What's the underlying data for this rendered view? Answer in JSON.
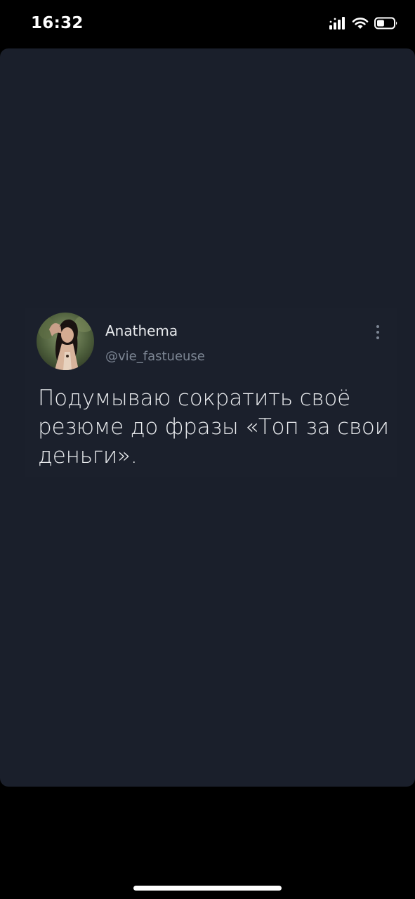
{
  "status_bar": {
    "time": "16:32",
    "signal_icon": "cellular-signal-icon",
    "wifi_icon": "wifi-icon",
    "battery_icon": "battery-icon",
    "battery_level": 0.45
  },
  "tweet": {
    "author_name": "Anathema",
    "author_handle": "@vie_fastueuse",
    "text": "Подумываю сократить своё резюме до фразы «Топ за свои деньги».",
    "avatar_icon": "avatar",
    "more_icon": "more-vertical-icon"
  },
  "colors": {
    "background": "#000000",
    "card": "#1a1f2b",
    "text_primary": "#e8eaed",
    "text_secondary": "#7d8694"
  }
}
